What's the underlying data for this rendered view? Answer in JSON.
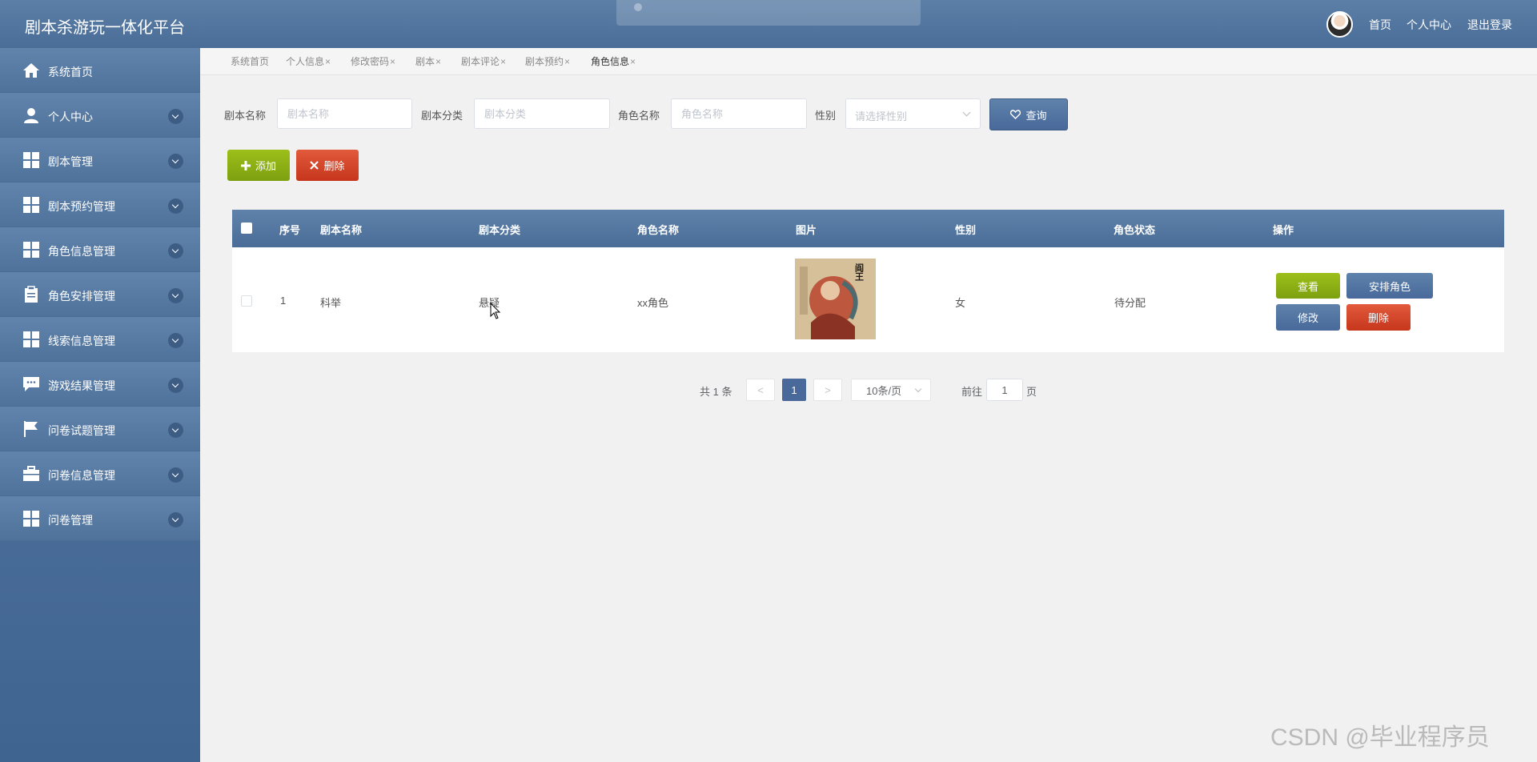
{
  "header": {
    "app_title": "剧本杀游玩一体化平台",
    "toast_text": "",
    "nav": [
      "首页",
      "个人中心",
      "退出登录"
    ]
  },
  "sidebar": {
    "items": [
      {
        "label": "系统首页",
        "icon": "home-icon",
        "has_chevron": false
      },
      {
        "label": "个人中心",
        "icon": "user-icon",
        "has_chevron": true
      },
      {
        "label": "剧本管理",
        "icon": "grid-icon",
        "has_chevron": true
      },
      {
        "label": "剧本预约管理",
        "icon": "grid-icon",
        "has_chevron": true
      },
      {
        "label": "角色信息管理",
        "icon": "grid-icon",
        "has_chevron": true
      },
      {
        "label": "角色安排管理",
        "icon": "clipboard-icon",
        "has_chevron": true
      },
      {
        "label": "线索信息管理",
        "icon": "grid-icon",
        "has_chevron": true
      },
      {
        "label": "游戏结果管理",
        "icon": "chat-icon",
        "has_chevron": true
      },
      {
        "label": "问卷试题管理",
        "icon": "flag-icon",
        "has_chevron": true
      },
      {
        "label": "问卷信息管理",
        "icon": "briefcase-icon",
        "has_chevron": true
      },
      {
        "label": "问卷管理",
        "icon": "grid-icon",
        "has_chevron": true
      }
    ]
  },
  "tabs": [
    {
      "label": "系统首页",
      "closable": false,
      "active": false
    },
    {
      "label": "个人信息",
      "closable": true,
      "active": false
    },
    {
      "label": "修改密码",
      "closable": true,
      "active": false
    },
    {
      "label": "剧本",
      "closable": true,
      "active": false
    },
    {
      "label": "剧本评论",
      "closable": true,
      "active": false
    },
    {
      "label": "剧本预约",
      "closable": true,
      "active": false
    },
    {
      "label": "角色信息",
      "closable": true,
      "active": true
    }
  ],
  "tab_close_glyph": "×",
  "search": {
    "script_name_label": "剧本名称",
    "script_name_placeholder": "剧本名称",
    "script_category_label": "剧本分类",
    "script_category_placeholder": "剧本分类",
    "role_name_label": "角色名称",
    "role_name_placeholder": "角色名称",
    "gender_label": "性别",
    "gender_placeholder": "请选择性别",
    "query_label": "查询"
  },
  "actions": {
    "add_label": "添加",
    "delete_label": "删除"
  },
  "table": {
    "columns": [
      "序号",
      "剧本名称",
      "剧本分类",
      "角色名称",
      "图片",
      "性别",
      "角色状态",
      "操作"
    ],
    "rows": [
      {
        "index": "1",
        "script_name": "科举",
        "script_category": "悬疑",
        "role_name": "xx角色",
        "image_title": "阎王",
        "gender": "女",
        "status": "待分配",
        "buttons": {
          "view": "查看",
          "arrange": "安排角色",
          "edit": "修改",
          "delete": "删除"
        }
      }
    ]
  },
  "pagination": {
    "total_text": "共 1 条",
    "prev": "<",
    "current_page": "1",
    "next": ">",
    "page_size": "10条/页",
    "goto_label": "前往",
    "goto_value": "1",
    "page_suffix": "页"
  },
  "watermark": "CSDN @毕业程序员",
  "colors": {
    "primary": "#48699a",
    "success": "#8bb014",
    "danger": "#d5452a",
    "background": "#f1f1f1"
  }
}
